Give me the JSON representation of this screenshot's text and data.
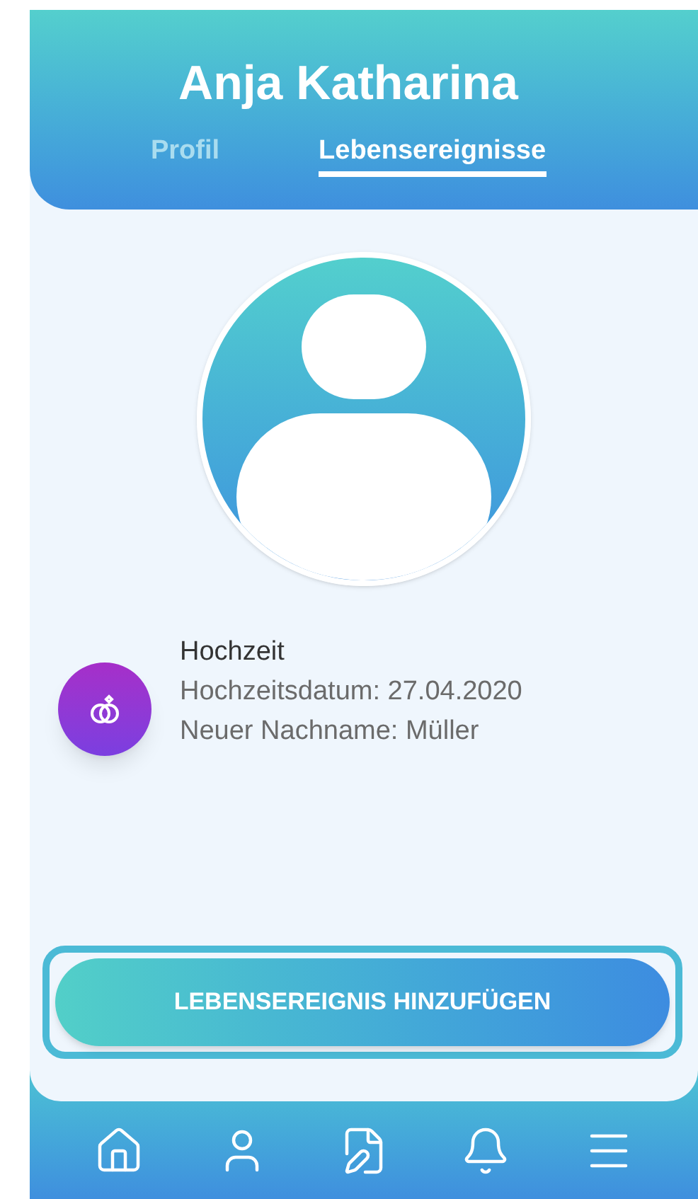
{
  "header": {
    "title": "Anja Katharina"
  },
  "tabs": [
    {
      "label": "Profil",
      "selected": false
    },
    {
      "label": "Lebensereignisse",
      "selected": true
    }
  ],
  "events": [
    {
      "kind": "wedding",
      "title": "Hochzeit",
      "lines": [
        "Hochzeitsdatum: 27.04.2020",
        "Neuer Nachname: Müller"
      ]
    }
  ],
  "action_button": {
    "label": "LEBENSEREIGNIS HINZUFÜGEN",
    "highlighted": true
  },
  "nav": [
    {
      "kind": "home"
    },
    {
      "kind": "profile"
    },
    {
      "kind": "edit"
    },
    {
      "kind": "notifications"
    },
    {
      "kind": "menu"
    }
  ]
}
